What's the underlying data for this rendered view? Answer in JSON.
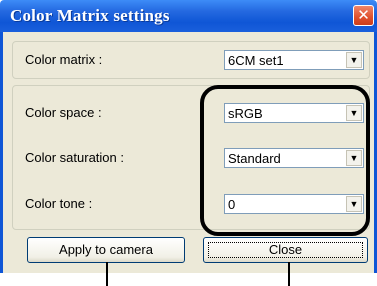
{
  "window": {
    "title": "Color Matrix settings",
    "close_glyph": "✕"
  },
  "fields": {
    "color_matrix": {
      "label": "Color matrix :",
      "value": "6CM set1"
    },
    "color_space": {
      "label": "Color space :",
      "value": "sRGB"
    },
    "color_saturation": {
      "label": "Color saturation :",
      "value": "Standard"
    },
    "color_tone": {
      "label": "Color tone :",
      "value": "0"
    }
  },
  "buttons": {
    "apply": "Apply to camera",
    "close": "Close"
  },
  "icons": {
    "dropdown": "chevron-down-icon",
    "dropdown_glyph": "▼",
    "title_close": "close-icon"
  },
  "colors": {
    "titlebar": "#0f56d6",
    "dialog_bg": "#ece9d8",
    "close_button": "#e0502c",
    "highlight_ring": "#000000"
  }
}
